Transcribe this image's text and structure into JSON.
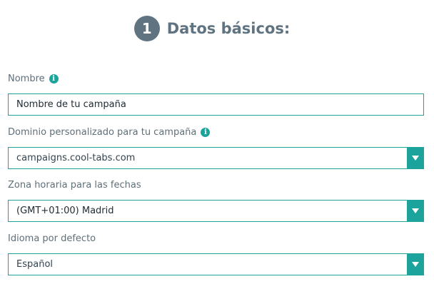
{
  "section": {
    "step_number": "1",
    "title": "Datos básicos:"
  },
  "fields": {
    "name": {
      "label": "Nombre",
      "value": "Nombre de tu campaña",
      "info_icon": "info-icon"
    },
    "domain": {
      "label": "Dominio personalizado para tu campaña",
      "selected": "campaigns.cool-tabs.com",
      "info_icon": "info-icon"
    },
    "timezone": {
      "label": "Zona horaria para las fechas",
      "selected": "(GMT+01:00) Madrid"
    },
    "language": {
      "label": "Idioma por defecto",
      "selected": "Español"
    }
  },
  "colors": {
    "accent": "#1ba39c",
    "heading": "#5f7380",
    "label": "#5f6f78"
  }
}
